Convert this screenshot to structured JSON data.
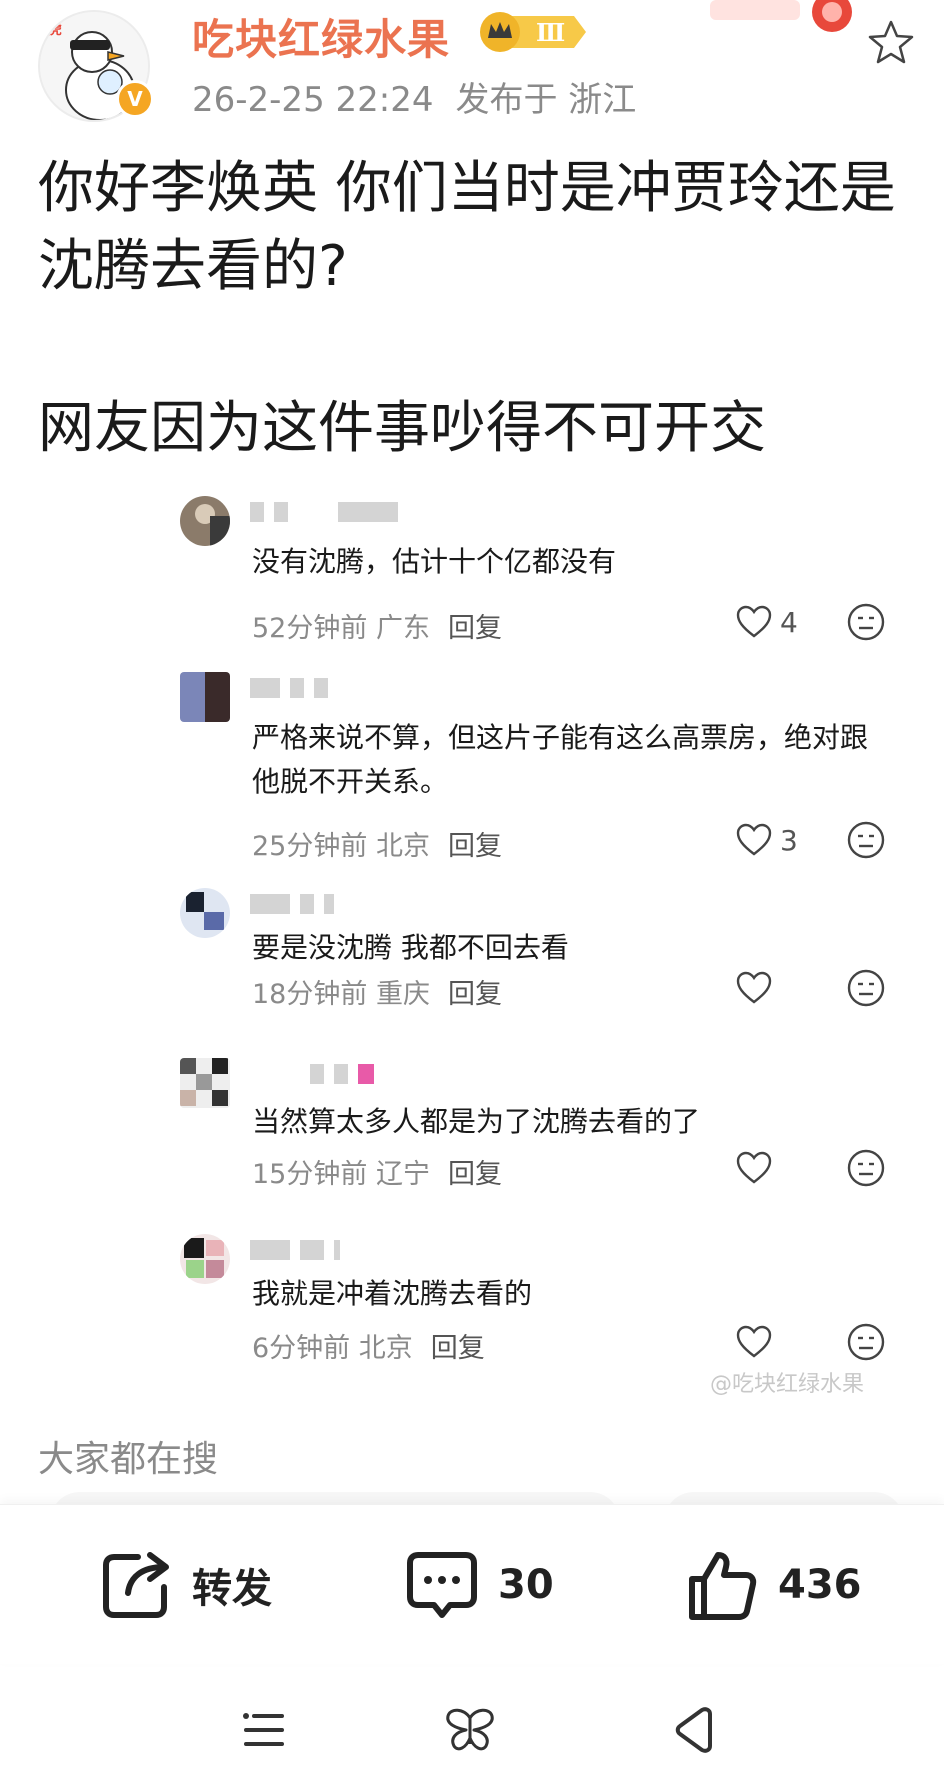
{
  "header": {
    "username": "吃块红绿水果",
    "level": "Ⅲ",
    "avatar_badge": "V",
    "timestamp": "26-2-25 22:24",
    "published_from": "发布于 浙江"
  },
  "post": {
    "paragraph_1": "你好李焕英 你们当时是冲贾玲还是沈腾去看的?",
    "paragraph_2": "网友因为这件事吵得不可开交"
  },
  "comments": [
    {
      "text": "没有沈腾，估计十个亿都没有",
      "time": "52分钟前",
      "location": "广东",
      "reply": "回复",
      "likes": "4"
    },
    {
      "text": "严格来说不算，但这片子能有这么高票房，绝对跟他脱不开关系。",
      "time": "25分钟前",
      "location": "北京",
      "reply": "回复",
      "likes": "3"
    },
    {
      "text": "要是没沈腾 我都不回去看",
      "time": "18分钟前",
      "location": "重庆",
      "reply": "回复",
      "likes": ""
    },
    {
      "text": "当然算太多人都是为了沈腾去看的了",
      "time": "15分钟前",
      "location": "辽宁",
      "reply": "回复",
      "likes": ""
    },
    {
      "text": "我就是冲着沈腾去看的",
      "time": "6分钟前",
      "location": "北京",
      "reply": "回复",
      "likes": ""
    }
  ],
  "watermark": "@吃块红绿水果",
  "search_section": {
    "title": "大家都在搜"
  },
  "actions": {
    "repost_label": "转发",
    "comment_count": "30",
    "like_count": "436"
  },
  "colors": {
    "username": "#eb7350",
    "badge": "#f5a623",
    "meta_gray": "#8a8a8a"
  },
  "icons": [
    "star-icon",
    "repost-icon",
    "comment-icon",
    "thumb-up-icon",
    "heart-icon",
    "emoji-icon",
    "menu-icon",
    "butterfly-icon",
    "back-icon"
  ]
}
